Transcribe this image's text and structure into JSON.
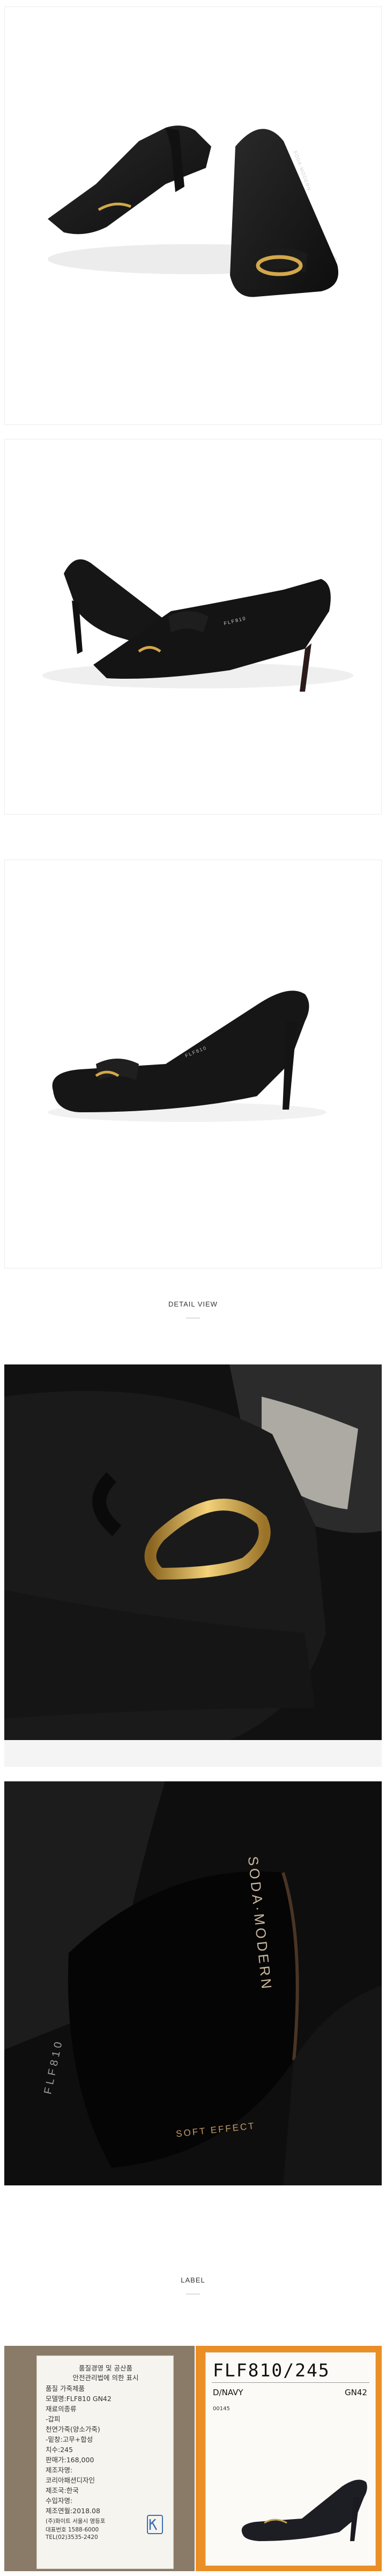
{
  "sections": {
    "detail_heading": "DETAIL VIEW",
    "label_heading": "LABEL"
  },
  "shoe": {
    "brand_print": "SODA·MODERN",
    "insole_print": "SOFT EFFECT",
    "shank_print": "FLF810"
  },
  "label_card": {
    "lines": [
      "품질경영 및 공산품",
      "안전관리법에 의한 표시",
      "품질 가죽제품",
      "모델명:FLF810 GN42",
      "재료의종류",
      "-갑피",
      "천연가죽(양소가죽)",
      "-밑창:고무+합성",
      "치수:245",
      "판매가:168,000",
      "제조자명:",
      "코리아패션디자인",
      "제조국:한국",
      "수입자명:",
      "제조연월:2018.08",
      "(주)화이트 서울시 영등포",
      "대표번호 1588-6000",
      "TEL(02)3535-2420"
    ]
  },
  "tag": {
    "code": "FLF810/245",
    "color": "D/NAVY",
    "variant": "GN42",
    "number": "00145"
  },
  "colors": {
    "accent_orange": "#e98f26",
    "leather_black": "#151515",
    "gold": "#d3a84a"
  }
}
